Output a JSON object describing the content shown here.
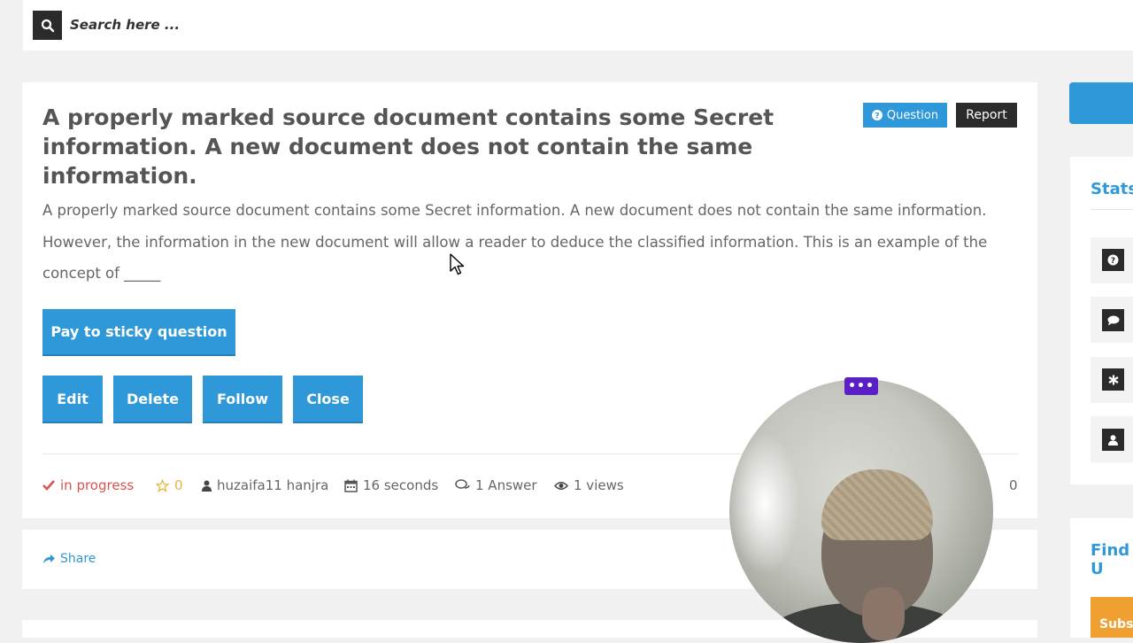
{
  "search": {
    "placeholder": "Search here ..."
  },
  "question": {
    "title": "A properly marked source document contains some Secret information. A new document does not contain the same information.",
    "badge_question": "Question",
    "badge_report": "Report",
    "body": "A properly marked source document contains some Secret information. A new document does not contain the same information. However, the information in the new document will allow a reader to deduce the classified information. This is an example of the concept of _____",
    "actions": {
      "pay": "Pay to sticky question",
      "edit": "Edit",
      "delete": "Delete",
      "follow": "Follow",
      "close": "Close"
    },
    "meta": {
      "status": "in progress",
      "favorites": "0",
      "author": "huzaifa11 hanjra",
      "time": "16 seconds",
      "answers": "1 Answer",
      "views": "1 views",
      "votes": "0"
    },
    "share": "Share"
  },
  "sidebar": {
    "stats_title": "Stats",
    "find_title": "Find U",
    "subscribe": "Subs",
    "stat_icons": [
      "question-icon",
      "comment-icon",
      "asterisk-icon",
      "user-icon"
    ]
  },
  "webcam": {
    "menu": "•••"
  },
  "colors": {
    "accent": "#2f98d8",
    "dark": "#2b2b2b",
    "status": "#d9534f",
    "star": "#e3b63d",
    "subscribe": "#f0a030",
    "webcam_menu": "#5b1fc6"
  }
}
